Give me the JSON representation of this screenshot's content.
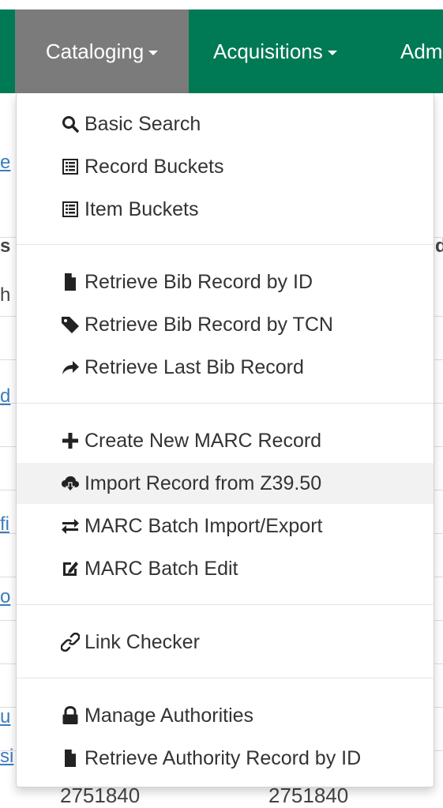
{
  "nav": {
    "items": [
      {
        "label": "Cataloging",
        "active": true
      },
      {
        "label": "Acquisitions",
        "active": false
      },
      {
        "label": "Adm",
        "active": false
      }
    ]
  },
  "background": {
    "fragments": [
      "e",
      "s",
      "d",
      "h",
      "d",
      "fi",
      "o",
      "u",
      "si",
      "2751840",
      "2751840"
    ]
  },
  "menu": {
    "groups": [
      [
        {
          "label": "Basic Search",
          "icon": "search-icon"
        },
        {
          "label": "Record Buckets",
          "icon": "list-alt-icon"
        },
        {
          "label": "Item Buckets",
          "icon": "list-alt-icon"
        }
      ],
      [
        {
          "label": "Retrieve Bib Record by ID",
          "icon": "file-icon"
        },
        {
          "label": "Retrieve Bib Record by TCN",
          "icon": "tag-icon"
        },
        {
          "label": "Retrieve Last Bib Record",
          "icon": "share-arrow-icon"
        }
      ],
      [
        {
          "label": "Create New MARC Record",
          "icon": "plus-icon"
        },
        {
          "label": "Import Record from Z39.50",
          "icon": "cloud-download-icon",
          "hover": true
        },
        {
          "label": "MARC Batch Import/Export",
          "icon": "transfer-icon"
        },
        {
          "label": "MARC Batch Edit",
          "icon": "edit-icon"
        }
      ],
      [
        {
          "label": "Link Checker",
          "icon": "link-icon"
        }
      ],
      [
        {
          "label": "Manage Authorities",
          "icon": "lock-icon"
        },
        {
          "label": "Retrieve Authority Record by ID",
          "icon": "file-icon"
        }
      ]
    ]
  }
}
